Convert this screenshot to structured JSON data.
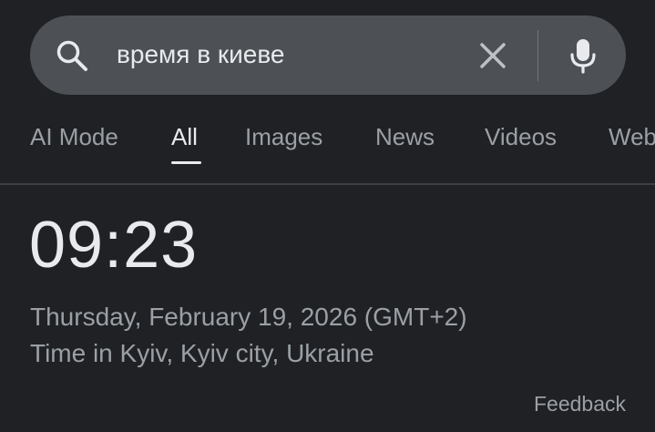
{
  "search": {
    "query": "время в киеве"
  },
  "icons": {
    "search": "search-icon",
    "clear": "close-icon",
    "mic": "microphone-icon"
  },
  "tabs": [
    {
      "label": "AI Mode",
      "active": false
    },
    {
      "label": "All",
      "active": true
    },
    {
      "label": "Images",
      "active": false
    },
    {
      "label": "News",
      "active": false
    },
    {
      "label": "Videos",
      "active": false
    },
    {
      "label": "Web",
      "active": false
    }
  ],
  "result": {
    "time": "09:23",
    "date": "Thursday, February 19, 2026 (GMT+2)",
    "place": "Time in Kyiv, Kyiv city, Ukraine"
  },
  "footer": {
    "feedback_label": "Feedback"
  },
  "colors": {
    "background": "#202124",
    "search_bar": "#4d5156",
    "text_primary": "#e8eaed",
    "text_secondary": "#9aa0a6"
  }
}
